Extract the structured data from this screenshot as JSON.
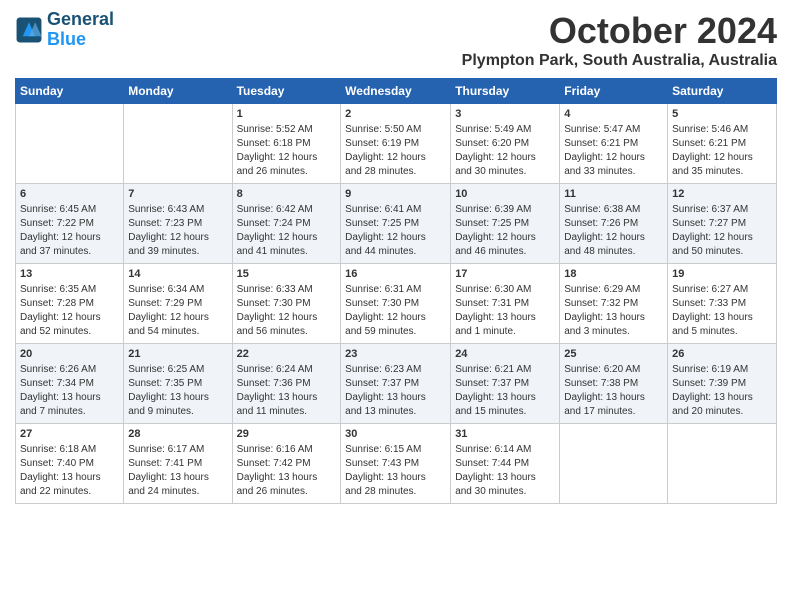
{
  "header": {
    "logo_general": "General",
    "logo_blue": "Blue",
    "month_title": "October 2024",
    "location": "Plympton Park, South Australia, Australia"
  },
  "days_of_week": [
    "Sunday",
    "Monday",
    "Tuesday",
    "Wednesday",
    "Thursday",
    "Friday",
    "Saturday"
  ],
  "weeks": [
    [
      {
        "day": "",
        "content": ""
      },
      {
        "day": "",
        "content": ""
      },
      {
        "day": "1",
        "content": "Sunrise: 5:52 AM\nSunset: 6:18 PM\nDaylight: 12 hours\nand 26 minutes."
      },
      {
        "day": "2",
        "content": "Sunrise: 5:50 AM\nSunset: 6:19 PM\nDaylight: 12 hours\nand 28 minutes."
      },
      {
        "day": "3",
        "content": "Sunrise: 5:49 AM\nSunset: 6:20 PM\nDaylight: 12 hours\nand 30 minutes."
      },
      {
        "day": "4",
        "content": "Sunrise: 5:47 AM\nSunset: 6:21 PM\nDaylight: 12 hours\nand 33 minutes."
      },
      {
        "day": "5",
        "content": "Sunrise: 5:46 AM\nSunset: 6:21 PM\nDaylight: 12 hours\nand 35 minutes."
      }
    ],
    [
      {
        "day": "6",
        "content": "Sunrise: 6:45 AM\nSunset: 7:22 PM\nDaylight: 12 hours\nand 37 minutes."
      },
      {
        "day": "7",
        "content": "Sunrise: 6:43 AM\nSunset: 7:23 PM\nDaylight: 12 hours\nand 39 minutes."
      },
      {
        "day": "8",
        "content": "Sunrise: 6:42 AM\nSunset: 7:24 PM\nDaylight: 12 hours\nand 41 minutes."
      },
      {
        "day": "9",
        "content": "Sunrise: 6:41 AM\nSunset: 7:25 PM\nDaylight: 12 hours\nand 44 minutes."
      },
      {
        "day": "10",
        "content": "Sunrise: 6:39 AM\nSunset: 7:25 PM\nDaylight: 12 hours\nand 46 minutes."
      },
      {
        "day": "11",
        "content": "Sunrise: 6:38 AM\nSunset: 7:26 PM\nDaylight: 12 hours\nand 48 minutes."
      },
      {
        "day": "12",
        "content": "Sunrise: 6:37 AM\nSunset: 7:27 PM\nDaylight: 12 hours\nand 50 minutes."
      }
    ],
    [
      {
        "day": "13",
        "content": "Sunrise: 6:35 AM\nSunset: 7:28 PM\nDaylight: 12 hours\nand 52 minutes."
      },
      {
        "day": "14",
        "content": "Sunrise: 6:34 AM\nSunset: 7:29 PM\nDaylight: 12 hours\nand 54 minutes."
      },
      {
        "day": "15",
        "content": "Sunrise: 6:33 AM\nSunset: 7:30 PM\nDaylight: 12 hours\nand 56 minutes."
      },
      {
        "day": "16",
        "content": "Sunrise: 6:31 AM\nSunset: 7:30 PM\nDaylight: 12 hours\nand 59 minutes."
      },
      {
        "day": "17",
        "content": "Sunrise: 6:30 AM\nSunset: 7:31 PM\nDaylight: 13 hours\nand 1 minute."
      },
      {
        "day": "18",
        "content": "Sunrise: 6:29 AM\nSunset: 7:32 PM\nDaylight: 13 hours\nand 3 minutes."
      },
      {
        "day": "19",
        "content": "Sunrise: 6:27 AM\nSunset: 7:33 PM\nDaylight: 13 hours\nand 5 minutes."
      }
    ],
    [
      {
        "day": "20",
        "content": "Sunrise: 6:26 AM\nSunset: 7:34 PM\nDaylight: 13 hours\nand 7 minutes."
      },
      {
        "day": "21",
        "content": "Sunrise: 6:25 AM\nSunset: 7:35 PM\nDaylight: 13 hours\nand 9 minutes."
      },
      {
        "day": "22",
        "content": "Sunrise: 6:24 AM\nSunset: 7:36 PM\nDaylight: 13 hours\nand 11 minutes."
      },
      {
        "day": "23",
        "content": "Sunrise: 6:23 AM\nSunset: 7:37 PM\nDaylight: 13 hours\nand 13 minutes."
      },
      {
        "day": "24",
        "content": "Sunrise: 6:21 AM\nSunset: 7:37 PM\nDaylight: 13 hours\nand 15 minutes."
      },
      {
        "day": "25",
        "content": "Sunrise: 6:20 AM\nSunset: 7:38 PM\nDaylight: 13 hours\nand 17 minutes."
      },
      {
        "day": "26",
        "content": "Sunrise: 6:19 AM\nSunset: 7:39 PM\nDaylight: 13 hours\nand 20 minutes."
      }
    ],
    [
      {
        "day": "27",
        "content": "Sunrise: 6:18 AM\nSunset: 7:40 PM\nDaylight: 13 hours\nand 22 minutes."
      },
      {
        "day": "28",
        "content": "Sunrise: 6:17 AM\nSunset: 7:41 PM\nDaylight: 13 hours\nand 24 minutes."
      },
      {
        "day": "29",
        "content": "Sunrise: 6:16 AM\nSunset: 7:42 PM\nDaylight: 13 hours\nand 26 minutes."
      },
      {
        "day": "30",
        "content": "Sunrise: 6:15 AM\nSunset: 7:43 PM\nDaylight: 13 hours\nand 28 minutes."
      },
      {
        "day": "31",
        "content": "Sunrise: 6:14 AM\nSunset: 7:44 PM\nDaylight: 13 hours\nand 30 minutes."
      },
      {
        "day": "",
        "content": ""
      },
      {
        "day": "",
        "content": ""
      }
    ]
  ]
}
